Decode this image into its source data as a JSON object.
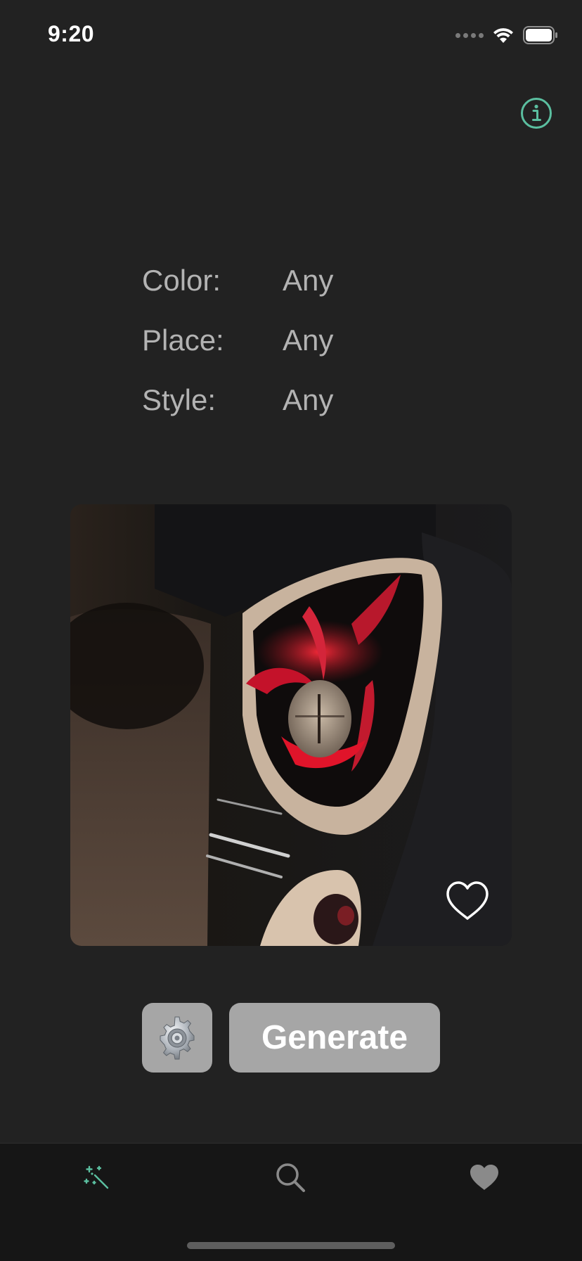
{
  "status_bar": {
    "time": "9:20"
  },
  "header": {
    "info_icon": "info-circle-icon",
    "accent_color": "#5bbfa0"
  },
  "filters": [
    {
      "label": "Color:",
      "value": "Any"
    },
    {
      "label": "Place:",
      "value": "Any"
    },
    {
      "label": "Style:",
      "value": "Any"
    }
  ],
  "tattoo_card": {
    "favorite_icon": "heart-outline-icon"
  },
  "actions": {
    "settings_icon": "gear-icon",
    "generate_label": "Generate"
  },
  "tab_bar": {
    "tabs": [
      {
        "icon": "magic-wand-icon",
        "active": true
      },
      {
        "icon": "search-icon",
        "active": false
      },
      {
        "icon": "heart-icon",
        "active": false
      }
    ],
    "active_color": "#5bbfa0",
    "inactive_color": "#8a8a8a"
  }
}
